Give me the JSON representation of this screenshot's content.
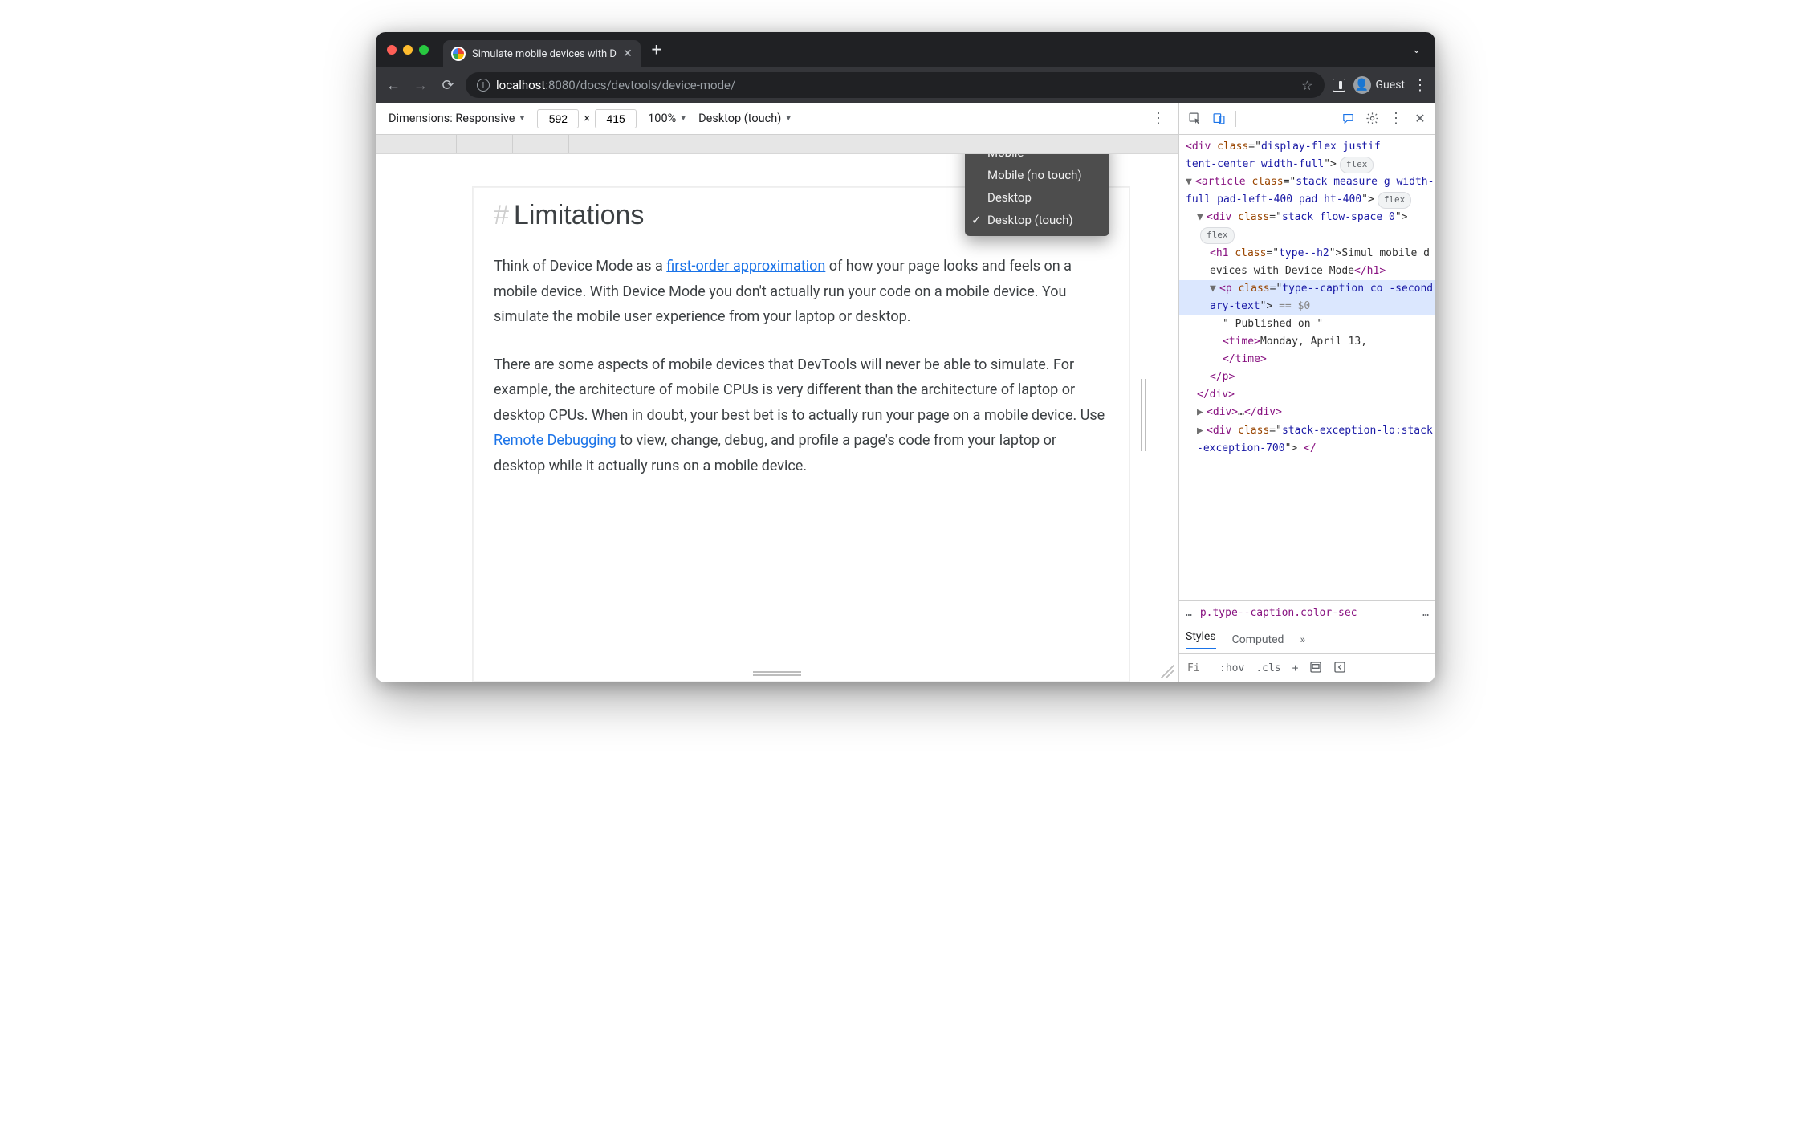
{
  "tab": {
    "title": "Simulate mobile devices with D"
  },
  "guest_label": "Guest",
  "url": {
    "host": "localhost",
    "port": ":8080",
    "path": "/docs/devtools/device-mode/"
  },
  "device_toolbar": {
    "dimensions_label": "Dimensions: Responsive",
    "width": "592",
    "times": "×",
    "height": "415",
    "zoom": "100%",
    "device_type": "Desktop (touch)",
    "menu": {
      "items": [
        "Mobile",
        "Mobile (no touch)",
        "Desktop",
        "Desktop (touch)"
      ],
      "checked_index": 3
    }
  },
  "page": {
    "hash": "#",
    "heading": "Limitations",
    "p1a": "Think of Device Mode as a ",
    "p1_link1": "first-order approximation",
    "p1b": " of how your page looks and feels on a mobile device. With Device Mode you don't actually run your code on a mobile device. You simulate the mobile user experience from your laptop or desktop.",
    "p2a": "There are some aspects of mobile devices that DevTools will never be able to simulate. For example, the architecture of mobile CPUs is very different than the architecture of laptop or desktop CPUs. When in doubt, your best bet is to actually run your page on a mobile device. Use ",
    "p2_link": "Remote Debugging",
    "p2b": " to view, change, debug, and profile a page's code from your laptop or desktop while it actually runs on a mobile device."
  },
  "elements": {
    "l1a": "<div ",
    "l1b": "class",
    "l1c": "=\"",
    "l1d": "display-flex justif",
    "l1e": "tent-center width-full",
    "l1f": "\">",
    "l1pill": "flex",
    "l2a": "<article ",
    "l2b": "class",
    "l2c": "=\"",
    "l2d": "stack measure g width-full pad-left-400 pad ht-400",
    "l2e": "\">",
    "l2pill": "flex",
    "l3a": "<div ",
    "l3b": "class",
    "l3c": "=\"",
    "l3d": "stack flow-space 0",
    "l3e": "\">",
    "l3pill": "flex",
    "l4a": "<h1 ",
    "l4b": "class",
    "l4c": "=\"",
    "l4d": "type--h2",
    "l4e": "\">",
    "l4txt": "Simul mobile devices with Device Mode",
    "l4close": "</h1>",
    "l5a": "<p ",
    "l5b": "class",
    "l5c": "=\"",
    "l5d": "type--caption co -secondary-text",
    "l5e": "\">",
    "l5eq": " == $0",
    "l6txt": "\" Published on \"",
    "l7a": "<time>",
    "l7txt": "Monday, April 13,",
    "l7close": "</time>",
    "l8": "</p>",
    "l9": "</div>",
    "l10a": "<div>",
    "l10b": "…",
    "l10c": "</div>",
    "l11a": "<div ",
    "l11b": "class",
    "l11c": "=\"",
    "l11d": "stack-exception-lo:stack-exception-700",
    "l11e": "\">",
    "l11f": " </"
  },
  "crumbs": {
    "dots": "…",
    "path": "p.type--caption.color-sec",
    "more": "…"
  },
  "styles": {
    "tab_styles": "Styles",
    "tab_computed": "Computed",
    "more": "»",
    "filter_placeholder": "Fi",
    "hov": ":hov",
    "cls": ".cls",
    "plus": "+"
  }
}
